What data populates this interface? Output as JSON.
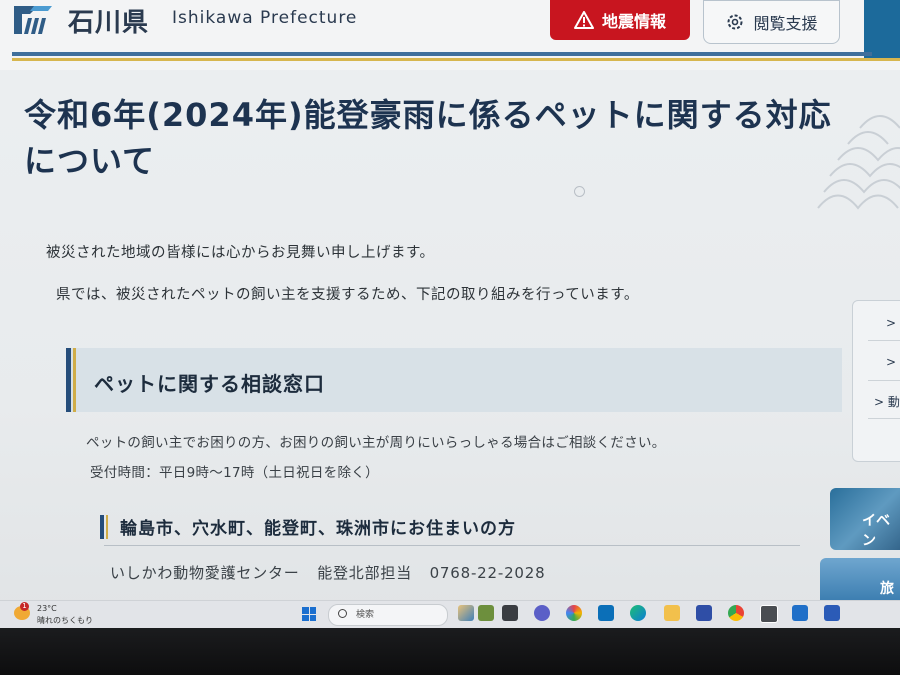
{
  "header": {
    "site_name": "石川県",
    "site_name_en": "Ishikawa Prefecture",
    "earthquake_button": "地震情報",
    "accessibility_button": "閲覧支援"
  },
  "main": {
    "title": "令和6年(2024年)能登豪雨に係るペットに関する対応について",
    "intro_1": "被災された地域の皆様には心からお見舞い申し上げます。",
    "intro_2": "県では、被災されたペットの飼い主を支援するため、下記の取り組みを行っています。",
    "section": {
      "title": "ペットに関する相談窓口",
      "description": "ペットの飼い主でお困りの方、お困りの飼い主が周りにいらっしゃる場合はご相談ください。",
      "hours": "受付時間：平日9時～17時（土日祝日を除く）",
      "subsection": {
        "title": "輪島市、穴水町、能登町、珠洲市にお住まいの方",
        "contact_org": "いしかわ動物愛護センター",
        "contact_dept": "能登北部担当",
        "contact_phone": "0768-22-2028"
      }
    }
  },
  "side": {
    "event_banner": "イベン",
    "tourism_banner": "旅",
    "arrow_1": ">",
    "arrow_2": ">",
    "arrow_3": "> 動"
  },
  "taskbar": {
    "weather_temp": "23°C",
    "weather_condition": "晴れのちくもり",
    "weather_badge": "1",
    "search_placeholder": "検索"
  },
  "colors": {
    "accent_red": "#c8151f",
    "navy": "#254d7a",
    "gold": "#d0ad48"
  }
}
